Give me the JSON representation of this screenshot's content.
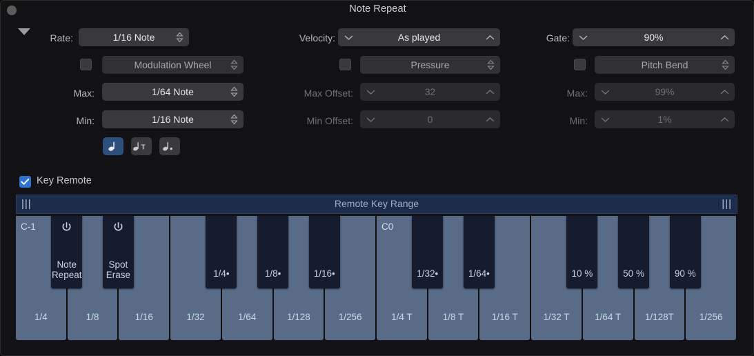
{
  "window": {
    "title": "Note Repeat",
    "close_button": "close",
    "disclosure": "collapse-triangle"
  },
  "controls": {
    "rate": {
      "label": "Rate:",
      "value": "1/16 Note",
      "modifier_label": "Modulation Wheel",
      "modifier_enabled": false,
      "max_label": "Max:",
      "max_value": "1/64 Note",
      "min_label": "Min:",
      "min_value": "1/16 Note",
      "disabled": false
    },
    "velocity": {
      "label": "Velocity:",
      "value": "As played",
      "modifier_label": "Pressure",
      "modifier_enabled": false,
      "max_label": "Max Offset:",
      "max_value": "32",
      "min_label": "Min Offset:",
      "min_value": "0",
      "disabled": true
    },
    "gate": {
      "label": "Gate:",
      "value": "90%",
      "modifier_label": "Pitch Bend",
      "modifier_enabled": false,
      "max_label": "Max:",
      "max_value": "99%",
      "min_label": "Min:",
      "min_value": "1%",
      "disabled": true
    }
  },
  "note_type_buttons": [
    {
      "name": "straight",
      "glyph": "note",
      "selected": true
    },
    {
      "name": "triplet",
      "glyph": "note-T",
      "selected": false
    },
    {
      "name": "dotted",
      "glyph": "note-dot",
      "selected": false
    }
  ],
  "key_remote": {
    "label": "Key Remote",
    "checked": true,
    "range_bar_title": "Remote Key Range",
    "grip_left": "|||",
    "grip_right": "|||"
  },
  "keyboard": {
    "octave_markers": [
      {
        "key_index": 0,
        "label": "C-1"
      },
      {
        "key_index": 7,
        "label": "C0"
      }
    ],
    "white_keys": [
      "1/4",
      "1/8",
      "1/16",
      "1/32",
      "1/64",
      "1/128",
      "1/256",
      "1/4 T",
      "1/8 T",
      "1/16 T",
      "1/32 T",
      "1/64 T",
      "1/128T",
      "1/256"
    ],
    "black_keys": [
      {
        "slot": 0,
        "label": "Note\nRepeat",
        "icon": "power-icon",
        "line1": "Note",
        "line2": "Repeat"
      },
      {
        "slot": 1,
        "label": "Spot\nErase",
        "icon": "power-icon",
        "line1": "Spot",
        "line2": "Erase"
      },
      {
        "slot": 3,
        "label": "1/4•"
      },
      {
        "slot": 4,
        "label": "1/8•"
      },
      {
        "slot": 5,
        "label": "1/16•"
      },
      {
        "slot": 7,
        "label": "1/32•"
      },
      {
        "slot": 8,
        "label": "1/64•"
      },
      {
        "slot": 10,
        "label": "10 %"
      },
      {
        "slot": 11,
        "label": "50 %"
      },
      {
        "slot": 12,
        "label": "90 %"
      }
    ]
  },
  "colors": {
    "window_bg": "#121214",
    "accent_blue": "#2f72cf",
    "white_key": "#586b87",
    "black_key": "#141c2e",
    "range_bar": "#1b2d4a",
    "control_bg": "#39393b",
    "selected_note_btn": "#2d4f7c"
  }
}
